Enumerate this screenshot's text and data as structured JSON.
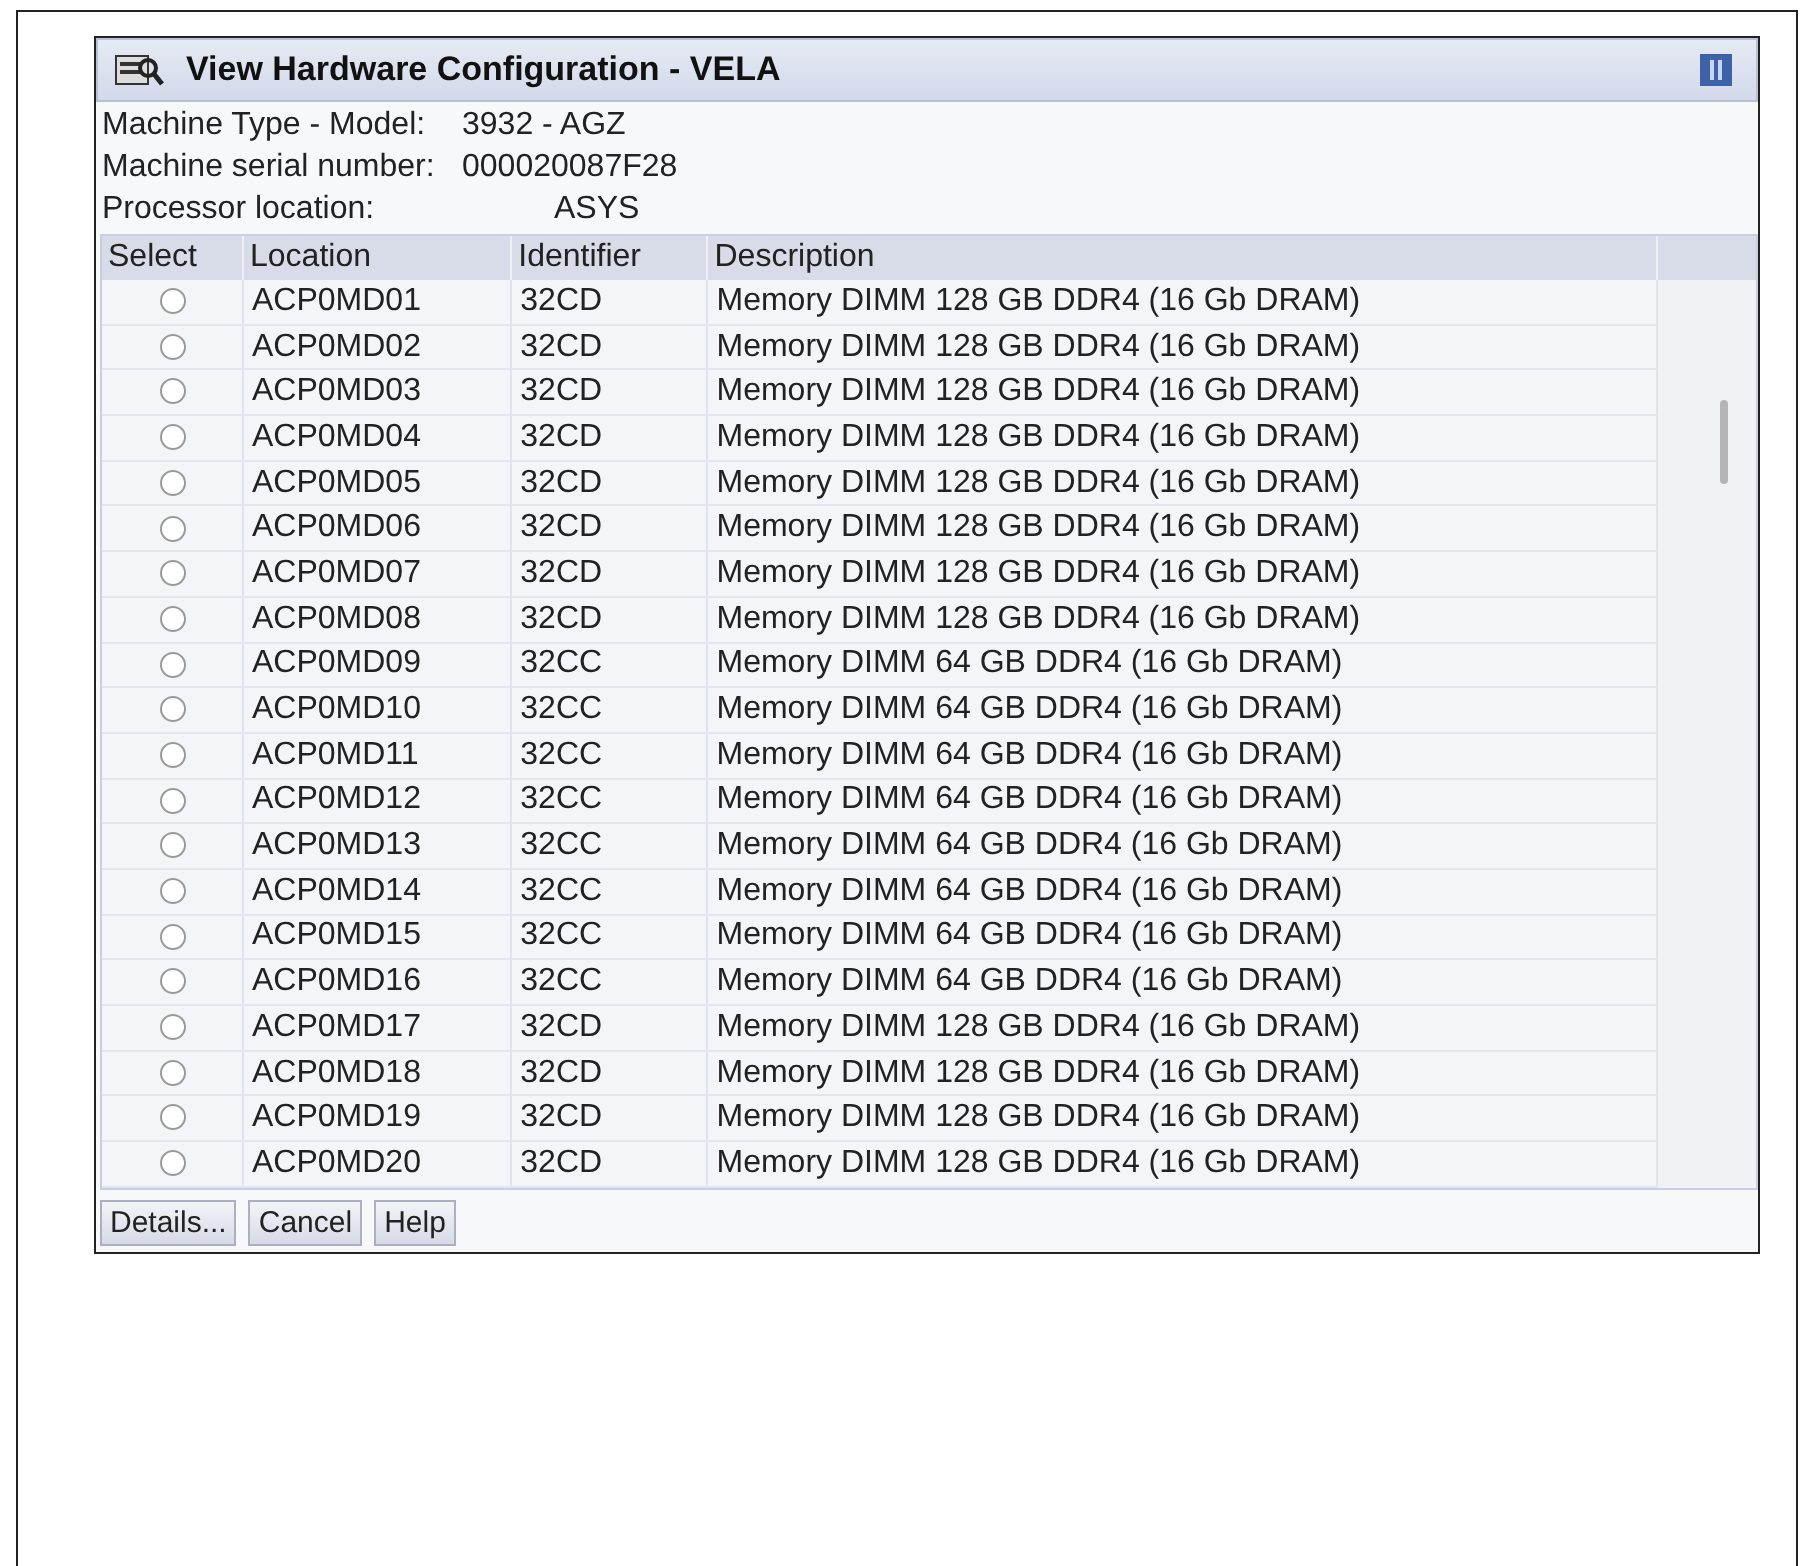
{
  "window": {
    "title": "View Hardware Configuration - VELA"
  },
  "info": [
    {
      "label": "Machine Type - Model:",
      "value": "3932 - AGZ"
    },
    {
      "label": "Machine serial number:",
      "value": "000020087F28"
    },
    {
      "label": "Processor location:",
      "value": "ASYS"
    }
  ],
  "table": {
    "columns": [
      "Select",
      "Location",
      "Identifier",
      "Description"
    ],
    "rows": [
      {
        "selected": false,
        "location": "ACP0MD01",
        "identifier": "32CD",
        "description": "Memory DIMM 128 GB DDR4 (16 Gb DRAM)"
      },
      {
        "selected": false,
        "location": "ACP0MD02",
        "identifier": "32CD",
        "description": "Memory DIMM 128 GB DDR4 (16 Gb DRAM)"
      },
      {
        "selected": false,
        "location": "ACP0MD03",
        "identifier": "32CD",
        "description": "Memory DIMM 128 GB DDR4 (16 Gb DRAM)"
      },
      {
        "selected": false,
        "location": "ACP0MD04",
        "identifier": "32CD",
        "description": "Memory DIMM 128 GB DDR4 (16 Gb DRAM)"
      },
      {
        "selected": false,
        "location": "ACP0MD05",
        "identifier": "32CD",
        "description": "Memory DIMM 128 GB DDR4 (16 Gb DRAM)"
      },
      {
        "selected": false,
        "location": "ACP0MD06",
        "identifier": "32CD",
        "description": "Memory DIMM 128 GB DDR4 (16 Gb DRAM)"
      },
      {
        "selected": false,
        "location": "ACP0MD07",
        "identifier": "32CD",
        "description": "Memory DIMM 128 GB DDR4 (16 Gb DRAM)"
      },
      {
        "selected": false,
        "location": "ACP0MD08",
        "identifier": "32CD",
        "description": "Memory DIMM 128 GB DDR4 (16 Gb DRAM)"
      },
      {
        "selected": false,
        "location": "ACP0MD09",
        "identifier": "32CC",
        "description": "Memory DIMM 64 GB DDR4 (16 Gb DRAM)"
      },
      {
        "selected": false,
        "location": "ACP0MD10",
        "identifier": "32CC",
        "description": "Memory DIMM 64 GB DDR4 (16 Gb DRAM)"
      },
      {
        "selected": false,
        "location": "ACP0MD11",
        "identifier": "32CC",
        "description": "Memory DIMM 64 GB DDR4 (16 Gb DRAM)"
      },
      {
        "selected": false,
        "location": "ACP0MD12",
        "identifier": "32CC",
        "description": "Memory DIMM 64 GB DDR4 (16 Gb DRAM)"
      },
      {
        "selected": false,
        "location": "ACP0MD13",
        "identifier": "32CC",
        "description": "Memory DIMM 64 GB DDR4 (16 Gb DRAM)"
      },
      {
        "selected": false,
        "location": "ACP0MD14",
        "identifier": "32CC",
        "description": "Memory DIMM 64 GB DDR4 (16 Gb DRAM)"
      },
      {
        "selected": false,
        "location": "ACP0MD15",
        "identifier": "32CC",
        "description": "Memory DIMM 64 GB DDR4 (16 Gb DRAM)"
      },
      {
        "selected": false,
        "location": "ACP0MD16",
        "identifier": "32CC",
        "description": "Memory DIMM 64 GB DDR4 (16 Gb DRAM)"
      },
      {
        "selected": false,
        "location": "ACP0MD17",
        "identifier": "32CD",
        "description": "Memory DIMM 128 GB DDR4 (16 Gb DRAM)"
      },
      {
        "selected": false,
        "location": "ACP0MD18",
        "identifier": "32CD",
        "description": "Memory DIMM 128 GB DDR4 (16 Gb DRAM)"
      },
      {
        "selected": false,
        "location": "ACP0MD19",
        "identifier": "32CD",
        "description": "Memory DIMM 128 GB DDR4 (16 Gb DRAM)"
      },
      {
        "selected": false,
        "location": "ACP0MD20",
        "identifier": "32CD",
        "description": "Memory DIMM 128 GB DDR4 (16 Gb DRAM)"
      }
    ]
  },
  "buttons": [
    "Details...",
    "Cancel",
    "Help"
  ]
}
